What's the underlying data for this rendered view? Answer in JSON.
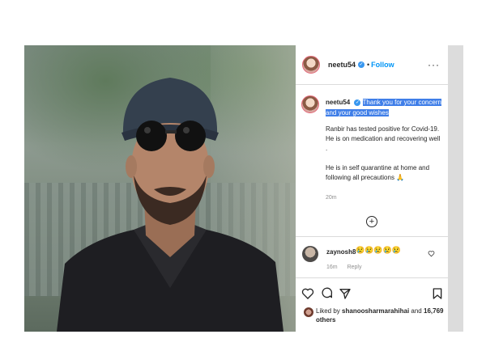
{
  "post": {
    "username": "neetu54",
    "verified_mark": "✓",
    "separator": "•",
    "follow_label": "Follow",
    "more_label": "···"
  },
  "caption": {
    "username": "neetu54",
    "highlighted_text": "Thank you for your concern and your good wishes",
    "paragraph_1": "Ranbir has tested positive for Covid-19. He is on medication and recovering well .",
    "paragraph_2": "He is in self quarantine at home and following all precautions 🙏",
    "time": "20m"
  },
  "load_more_icon": "+",
  "comment": {
    "username": "zaynosh8",
    "emojis": "😢😢😢😢😢",
    "time": "16m",
    "reply_label": "Reply",
    "like_icon": "heart-outline-icon"
  },
  "likes": {
    "prefix": "Liked by",
    "user": "shanoosharmarahihai",
    "middle": "and",
    "count": "16,769 others"
  },
  "icons": {
    "like": "heart-icon",
    "comment": "comment-icon",
    "share": "share-icon",
    "save": "bookmark-icon"
  },
  "colors": {
    "accent": "#0095f6",
    "highlight": "#3f7ee8",
    "meta": "#8e8e8e"
  }
}
